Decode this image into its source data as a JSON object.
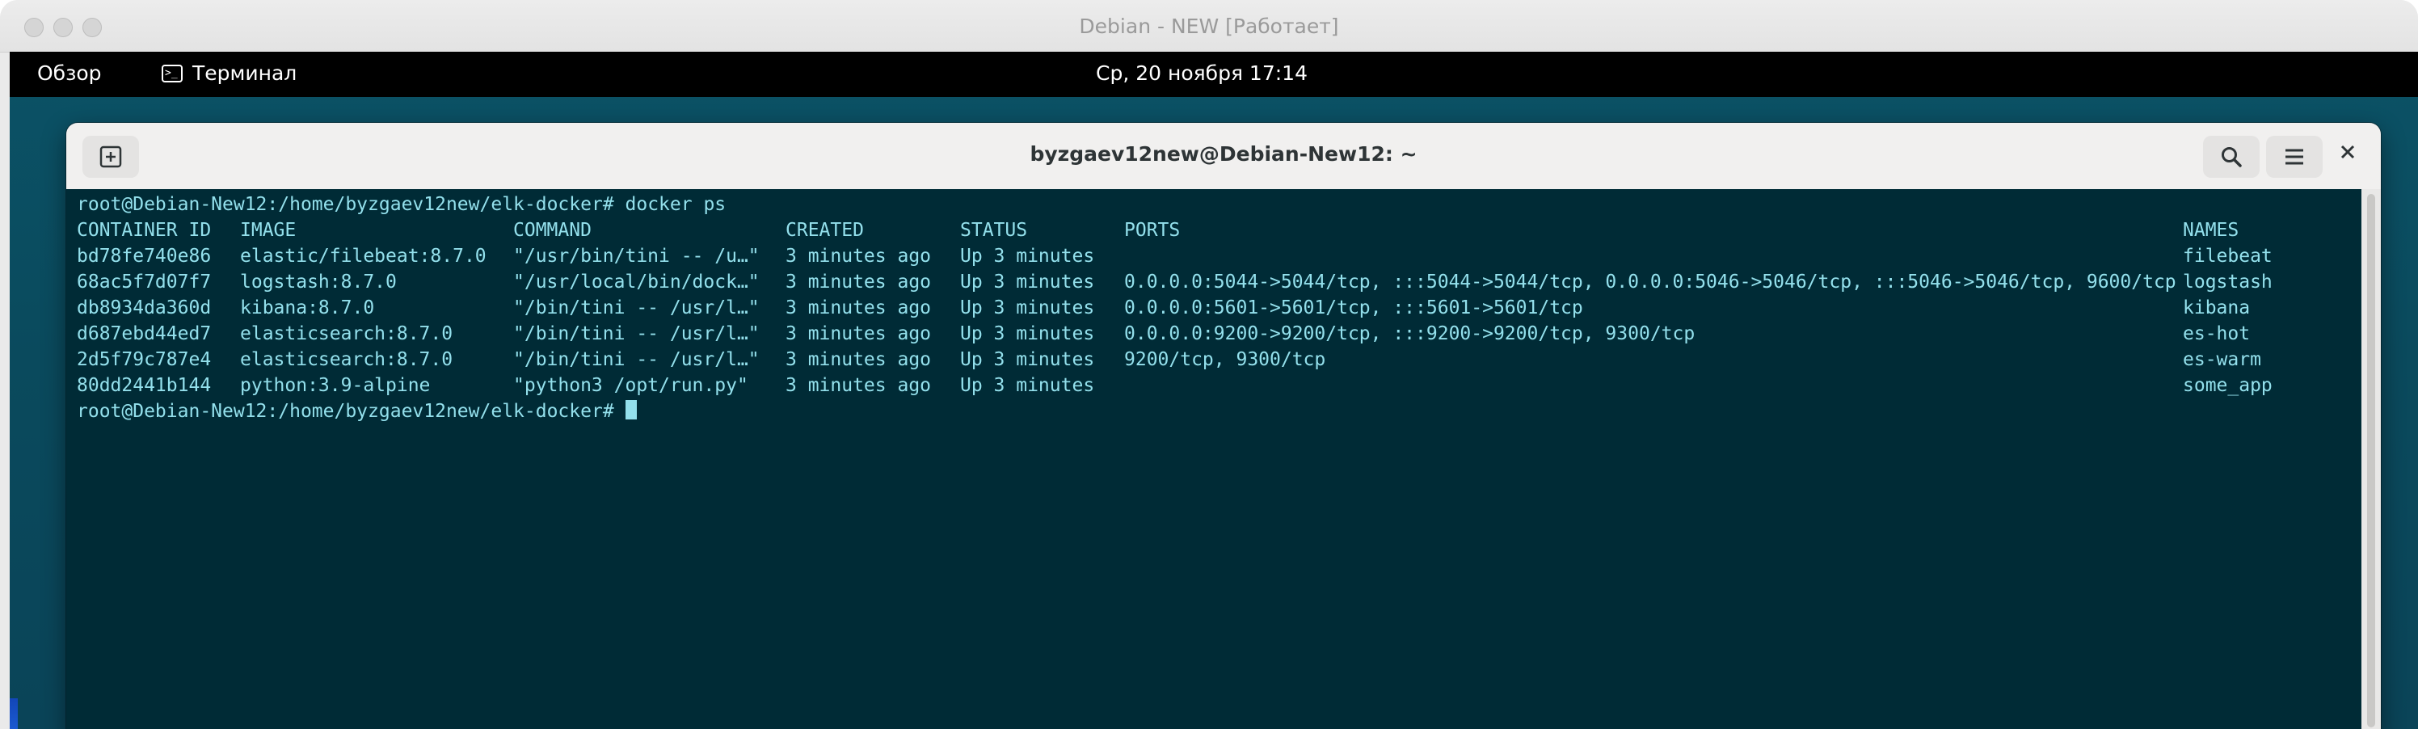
{
  "host": {
    "title": "Debian - NEW [Работает]"
  },
  "gnome_bar": {
    "activities": "Обзор",
    "app_name": "Терминал",
    "app_icon": "terminal-icon",
    "clock": "Ср, 20 ноября  17:14"
  },
  "terminal": {
    "title": "byzgaev12new@Debian-New12: ~",
    "icons": {
      "new_tab": "new-tab-icon",
      "search": "search-icon",
      "menu": "hamburger-menu-icon",
      "close": "close-icon"
    },
    "command_line": "root@Debian-New12:/home/byzgaev12new/elk-docker# docker ps",
    "final_prompt": "root@Debian-New12:/home/byzgaev12new/elk-docker# ",
    "headers": {
      "container_id": "CONTAINER ID",
      "image": "IMAGE",
      "command": "COMMAND",
      "created": "CREATED",
      "status": "STATUS",
      "ports": "PORTS",
      "names": "NAMES"
    },
    "rows": [
      {
        "id": "bd78fe740e86",
        "image": "elastic/filebeat:8.7.0",
        "command": "\"/usr/bin/tini -- /u…\"",
        "created": "3 minutes ago",
        "status": "Up 3 minutes",
        "ports": "",
        "name": "filebeat"
      },
      {
        "id": "68ac5f7d07f7",
        "image": "logstash:8.7.0",
        "command": "\"/usr/local/bin/dock…\"",
        "created": "3 minutes ago",
        "status": "Up 3 minutes",
        "ports": "0.0.0.0:5044->5044/tcp, :::5044->5044/tcp, 0.0.0.0:5046->5046/tcp, :::5046->5046/tcp, 9600/tcp",
        "name": "logstash"
      },
      {
        "id": "db8934da360d",
        "image": "kibana:8.7.0",
        "command": "\"/bin/tini -- /usr/l…\"",
        "created": "3 minutes ago",
        "status": "Up 3 minutes",
        "ports": "0.0.0.0:5601->5601/tcp, :::5601->5601/tcp",
        "name": "kibana"
      },
      {
        "id": "d687ebd44ed7",
        "image": "elasticsearch:8.7.0",
        "command": "\"/bin/tini -- /usr/l…\"",
        "created": "3 minutes ago",
        "status": "Up 3 minutes",
        "ports": "0.0.0.0:9200->9200/tcp, :::9200->9200/tcp, 9300/tcp",
        "name": "es-hot"
      },
      {
        "id": "2d5f79c787e4",
        "image": "elasticsearch:8.7.0",
        "command": "\"/bin/tini -- /usr/l…\"",
        "created": "3 minutes ago",
        "status": "Up 3 minutes",
        "ports": "9200/tcp, 9300/tcp",
        "name": "es-warm"
      },
      {
        "id": "80dd2441b144",
        "image": "python:3.9-alpine",
        "command": "\"python3 /opt/run.py\"",
        "created": "3 minutes ago",
        "status": "Up 3 minutes",
        "ports": "",
        "name": "some_app"
      }
    ],
    "colors": {
      "background": "#002b36",
      "text": "#93e0ec"
    }
  }
}
